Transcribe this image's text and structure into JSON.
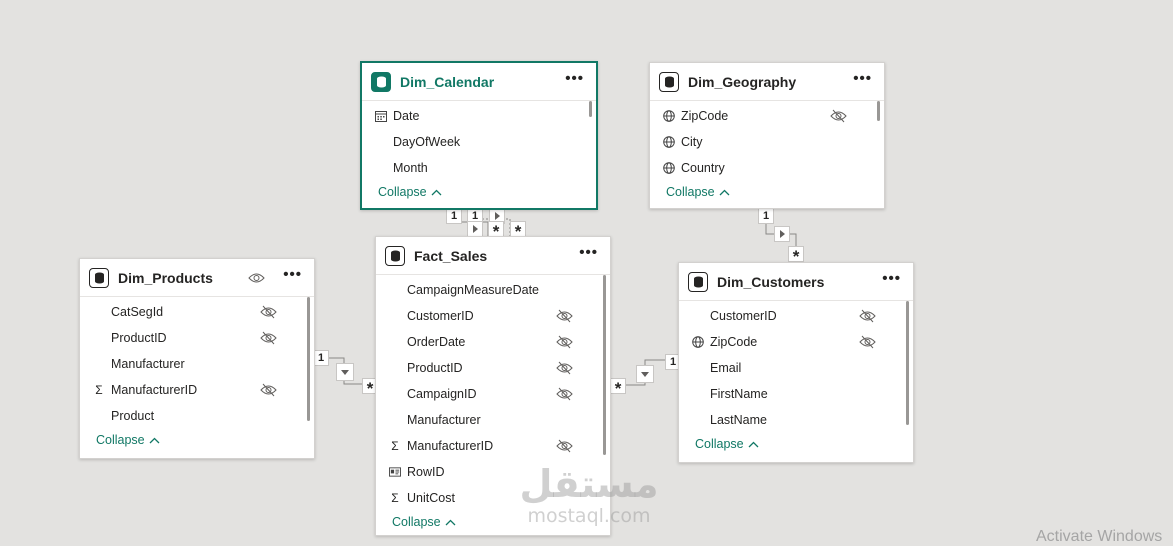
{
  "tables": {
    "dim_calendar": {
      "title": "Dim_Calendar",
      "fields": [
        "Date",
        "DayOfWeek",
        "Month"
      ],
      "collapse": "Collapse"
    },
    "dim_geography": {
      "title": "Dim_Geography",
      "fields": [
        "ZipCode",
        "City",
        "Country"
      ],
      "collapse": "Collapse"
    },
    "dim_products": {
      "title": "Dim_Products",
      "fields": [
        "CatSegId",
        "ProductID",
        "Manufacturer",
        "ManufacturerID",
        "Product"
      ],
      "collapse": "Collapse"
    },
    "fact_sales": {
      "title": "Fact_Sales",
      "fields": [
        "CampaignMeasureDate",
        "CustomerID",
        "OrderDate",
        "ProductID",
        "CampaignID",
        "Manufacturer",
        "ManufacturerID",
        "RowID",
        "UnitCost"
      ],
      "collapse": "Collapse"
    },
    "dim_customers": {
      "title": "Dim_Customers",
      "fields": [
        "CustomerID",
        "ZipCode",
        "Email",
        "FirstName",
        "LastName"
      ],
      "collapse": "Collapse"
    }
  },
  "more_label": "•••",
  "relationships": {
    "one": "1",
    "many": "*"
  },
  "watermark": {
    "logo": "مستقل",
    "url": "mostaql.com"
  },
  "os_notice": "Activate Windows",
  "colors": {
    "accent": "#117865",
    "canvas": "#e3e2e0"
  },
  "icons": {
    "table": "table-icon",
    "calendar": "calendar-icon",
    "globe": "globe-icon",
    "sigma": "sigma-icon",
    "id_card": "id-card-icon",
    "hidden": "eye-slash-icon",
    "visible": "eye-icon"
  }
}
